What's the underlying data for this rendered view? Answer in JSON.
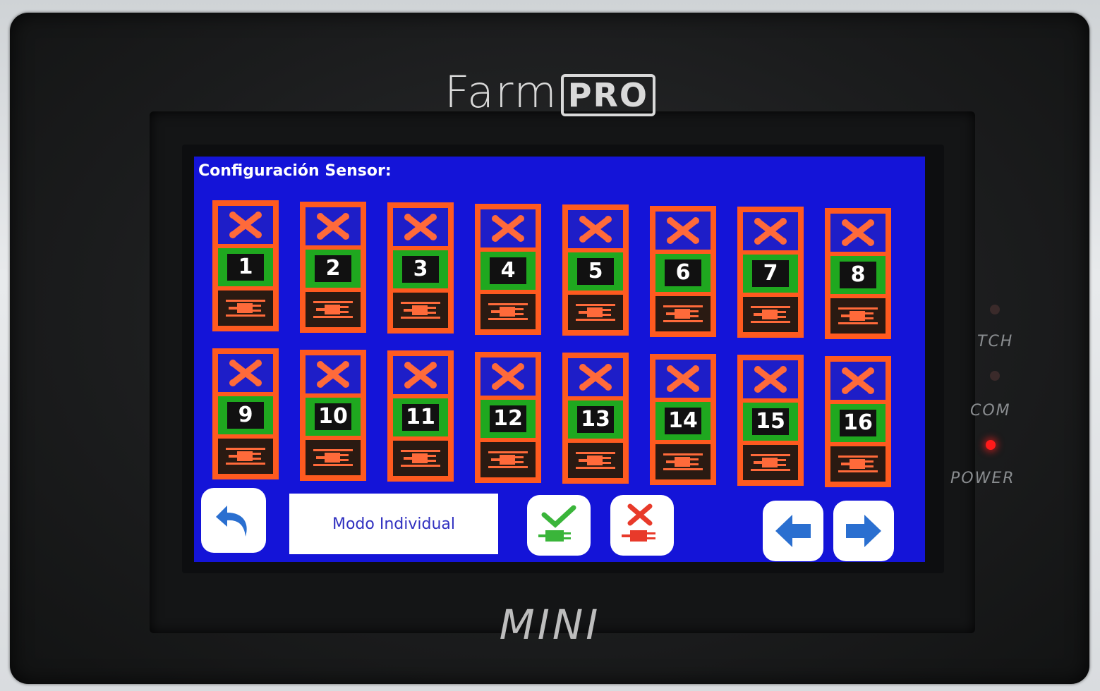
{
  "device": {
    "brand_main": "Farm",
    "brand_box": "PRO",
    "model": "MINI",
    "indicators": [
      {
        "label": "TCH",
        "on": false
      },
      {
        "label": "COM",
        "on": false
      },
      {
        "label": "POWER",
        "on": true
      }
    ]
  },
  "screen": {
    "title": "Configuración Sensor:",
    "sensors": [
      "1",
      "2",
      "3",
      "4",
      "5",
      "6",
      "7",
      "8",
      "9",
      "10",
      "11",
      "12",
      "13",
      "14",
      "15",
      "16"
    ],
    "mode_label": "Modo Individual"
  },
  "colors": {
    "lcd_bg": "#1414d8",
    "sensor_frame": "#ff5a1f",
    "sensor_number_bg": "#1fa81f",
    "disabled_x": "#ff6a3a",
    "power_led": "#ff1a1a"
  },
  "icons": {
    "status": "x-cross-icon",
    "connector": "plug-icon",
    "back": "undo-arrow-icon",
    "enable_all": "check-plug-icon",
    "disable_all": "x-plug-icon",
    "prev": "arrow-left-icon",
    "next": "arrow-right-icon"
  }
}
